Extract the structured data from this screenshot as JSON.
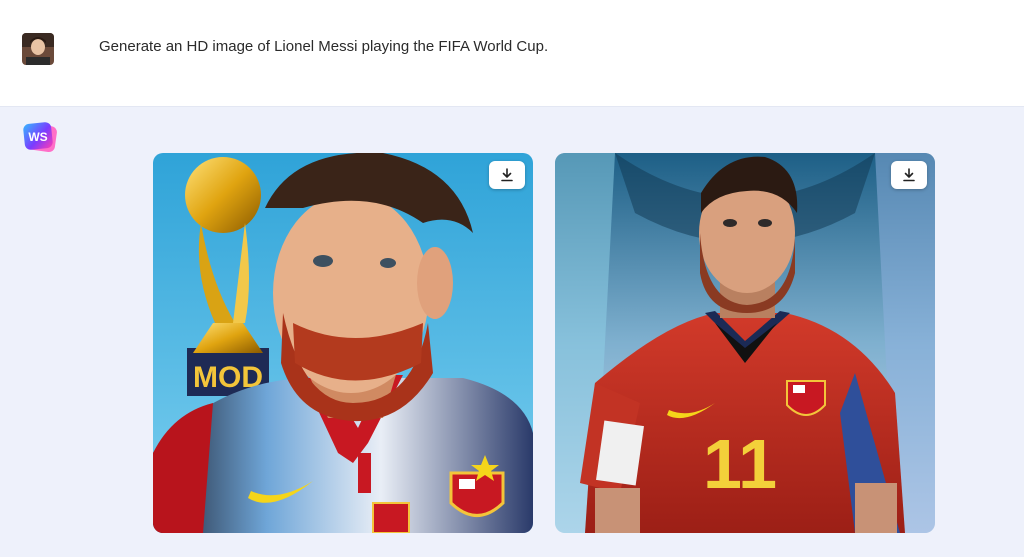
{
  "user": {
    "avatar_icon": "user-avatar-photo",
    "message": "Generate an HD image of Lionel Messi playing the FIFA World Cup."
  },
  "assistant": {
    "logo_text": "WS",
    "logo_colors": [
      "#35b8ff",
      "#7a3cff",
      "#ff3cb4"
    ],
    "images": [
      {
        "alt": "Lionel Messi with the FIFA World Cup trophy",
        "trophy_text": "MOD",
        "download_icon": "download-icon"
      },
      {
        "alt": "Lionel Messi in a red number 11 jersey",
        "jersey_number": "11",
        "download_icon": "download-icon"
      }
    ]
  },
  "colors": {
    "assistant_bg": "#eef1fb",
    "user_bg": "#ffffff",
    "text": "#2b2b2b"
  }
}
